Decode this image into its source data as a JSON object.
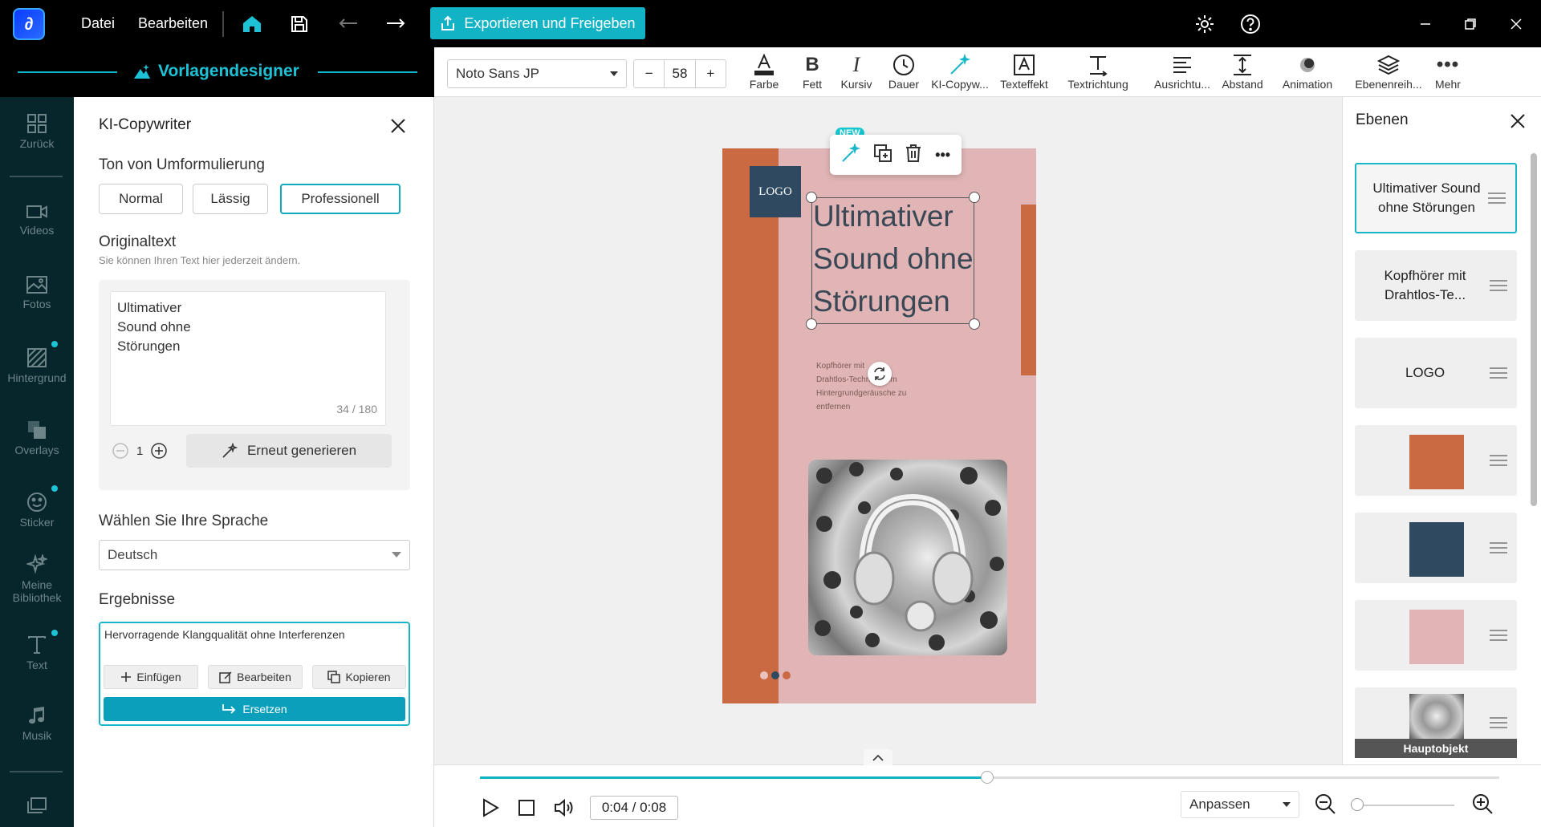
{
  "topbar": {
    "menu_file": "Datei",
    "menu_edit": "Bearbeiten",
    "export_label": "Exportieren und Freigeben"
  },
  "designer": {
    "title": "Vorlagendesigner"
  },
  "rail": {
    "items": [
      "Zurück",
      "Videos",
      "Fotos",
      "Hintergrund",
      "Overlays",
      "Sticker",
      "Meine Bibliothek",
      "Text",
      "Musik"
    ]
  },
  "copywriter": {
    "title": "KI-Copywriter",
    "tone_heading": "Ton von Umformulierung",
    "tones": [
      "Normal",
      "Lässig",
      "Professionell"
    ],
    "selected_tone": "Professionell",
    "original_heading": "Originaltext",
    "original_hint": "Sie können Ihren Text hier jederzeit ändern.",
    "original_lines": [
      "Ultimativer",
      "Sound ohne",
      "Störungen"
    ],
    "char_counter": "34 / 180",
    "count_value": "1",
    "regenerate_label": "Erneut generieren",
    "language_heading": "Wählen Sie Ihre Sprache",
    "language_value": "Deutsch",
    "results_heading": "Ergebnisse",
    "result_text": "Hervorragende Klangqualität ohne Interferenzen",
    "insert_label": "Einfügen",
    "edit_label": "Bearbeiten",
    "copy_label": "Kopieren",
    "replace_label": "Ersetzen"
  },
  "format": {
    "font": "Noto Sans JP",
    "font_size": "58",
    "tools": [
      "Farbe",
      "Fett",
      "Kursiv",
      "Dauer",
      "KI-Copyw...",
      "Texteffekt",
      "Textrichtung",
      "Ausrichtu...",
      "Abstand",
      "Animation",
      "Ebenenreih...",
      "Mehr"
    ]
  },
  "canvas": {
    "new_badge": "NEW",
    "logo_text": "LOGO",
    "headline_lines": [
      "Ultimativer",
      "Sound ohne",
      "Störungen"
    ],
    "sub_lines": [
      "Kopfhörer mit",
      "Drahtlos-Techno...   ...m",
      "Hintergrundgeräusche zu",
      "entfernen"
    ]
  },
  "layers": {
    "title": "Ebenen",
    "items": [
      {
        "label": "Ultimativer Sound ohne Störungen"
      },
      {
        "label": "Kopfhörer mit Drahtlos-Te..."
      },
      {
        "label": "LOGO"
      },
      {
        "swatch": "#c96a43"
      },
      {
        "swatch": "#2f4a60"
      },
      {
        "swatch": "#e1b5b5"
      },
      {
        "badge": "Hauptobjekt"
      }
    ]
  },
  "timeline": {
    "time": "0:04 / 0:08",
    "progress_fraction": 0.5,
    "fit_label": "Anpassen"
  },
  "colors": {
    "accent": "#13b3c6",
    "rail_bg": "#07262c",
    "orange": "#c96a43",
    "navy": "#2f4a60",
    "pink": "#e1b5b5"
  }
}
